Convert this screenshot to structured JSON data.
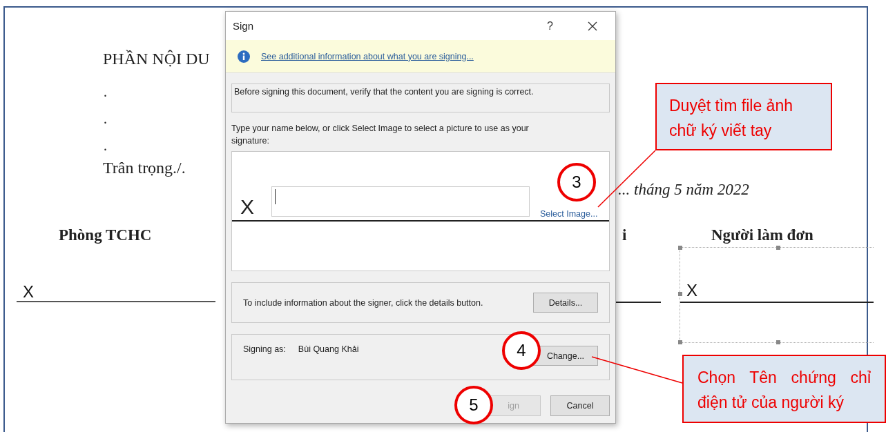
{
  "document": {
    "heading": "PHẦN NỘI DU",
    "bullets": [
      ".",
      ".",
      "."
    ],
    "closing": "Trân trọng./.",
    "date": "... tháng 5 năm 2022",
    "left_signer": {
      "title": "Phòng TCHC",
      "mark": "X"
    },
    "middle_signer_fragment": "i",
    "right_signer": {
      "title": "Người làm  đơn",
      "mark": "X"
    }
  },
  "dialog": {
    "title": "Sign",
    "help": "?",
    "info_link": "See additional information about what you are signing...",
    "notice": "Before signing this document, verify that the content you are signing is correct.",
    "instructions": "Type your name below, or click Select Image to select a picture to use as your signature:",
    "signature_mark": "X",
    "select_image": "Select Image...",
    "details_text": "To include information about the signer, click the details button.",
    "details_button": "Details...",
    "signing_as_label": "Signing as:",
    "signer_name": "Bùi Quang Khải",
    "change_button": "Change...",
    "buttons": [
      {
        "label": "ign",
        "disabled": true
      },
      {
        "label": "Cancel",
        "disabled": false
      }
    ]
  },
  "step_markers": [
    {
      "number": "3"
    },
    {
      "number": "4"
    },
    {
      "number": "5"
    }
  ],
  "callouts": [
    {
      "text": "Duyệt tìm file ảnh chữ ký viết tay"
    },
    {
      "text": "Chọn Tên chứng chỉ điện tử của người ký"
    }
  ]
}
